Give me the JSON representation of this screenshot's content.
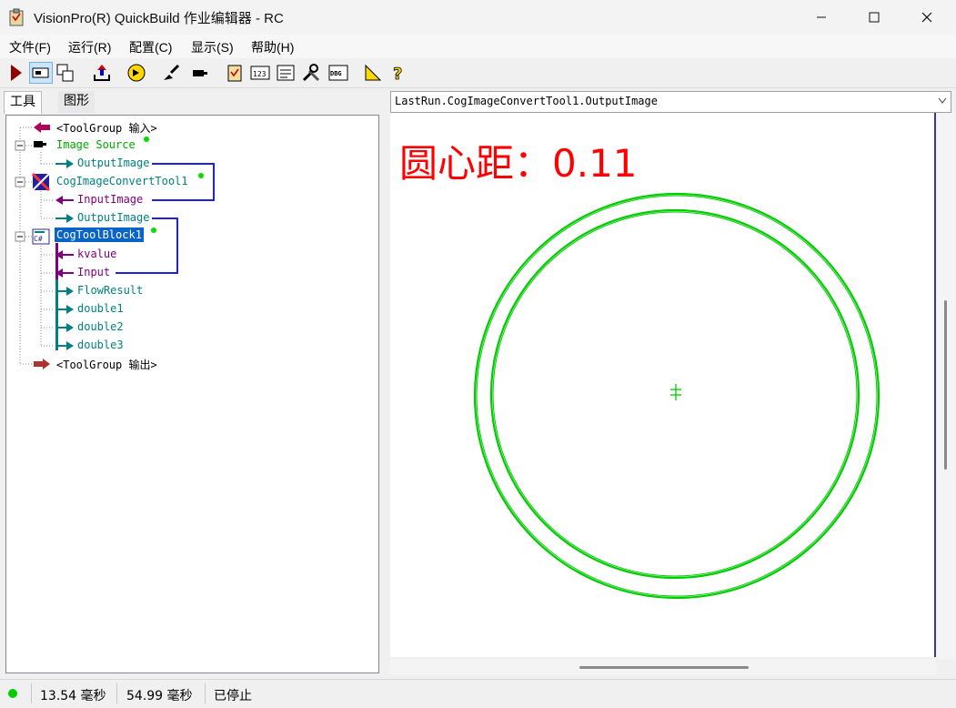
{
  "window": {
    "title": "VisionPro(R) QuickBuild 作业编辑器 - RC",
    "minimize_icon": "minimize-icon",
    "maximize_icon": "maximize-icon",
    "close_icon": "close-icon"
  },
  "menu": [
    "文件(F)",
    "运行(R)",
    "配置(C)",
    "显示(S)",
    "帮助(H)"
  ],
  "toolbar": [
    "run-icon",
    "display-icon",
    "windows-icon",
    "reset-icon",
    "continuous-icon",
    "brush-icon",
    "camera-icon",
    "clipboard-icon",
    "numbers-icon",
    "list-icon",
    "tools-icon",
    "debug-icon",
    "ruler-icon",
    "help-icon"
  ],
  "tabs": [
    "工具",
    "图形"
  ],
  "tree": [
    {
      "text": "<ToolGroup 输入>",
      "color": "#000000"
    },
    {
      "text": "Image Source",
      "color": "#00aa00"
    },
    {
      "text": "OutputImage",
      "color": "#008080"
    },
    {
      "text": "CogImageConvertTool1",
      "color": "#008080"
    },
    {
      "text": "InputImage",
      "color": "#800080"
    },
    {
      "text": "OutputImage",
      "color": "#008080"
    },
    {
      "text": "CogToolBlock1",
      "color": "#ffffff"
    },
    {
      "text": "kvalue",
      "color": "#800080"
    },
    {
      "text": "Input",
      "color": "#800080"
    },
    {
      "text": "FlowResult",
      "color": "#008080"
    },
    {
      "text": "double1",
      "color": "#008080"
    },
    {
      "text": "double2",
      "color": "#008080"
    },
    {
      "text": "double3",
      "color": "#008080"
    },
    {
      "text": "<ToolGroup 输出>",
      "color": "#000000"
    }
  ],
  "display": {
    "selected_image": "LastRun.CogImageConvertTool1.OutputImage",
    "overlay_label": "圆心距：0.11",
    "overlay_color": "#ff0000",
    "circle_color": "#00cc00"
  },
  "status": {
    "indicator_color": "#00cc00",
    "time1": "13.54 毫秒",
    "time2": "54.99 毫秒",
    "state": "已停止"
  }
}
